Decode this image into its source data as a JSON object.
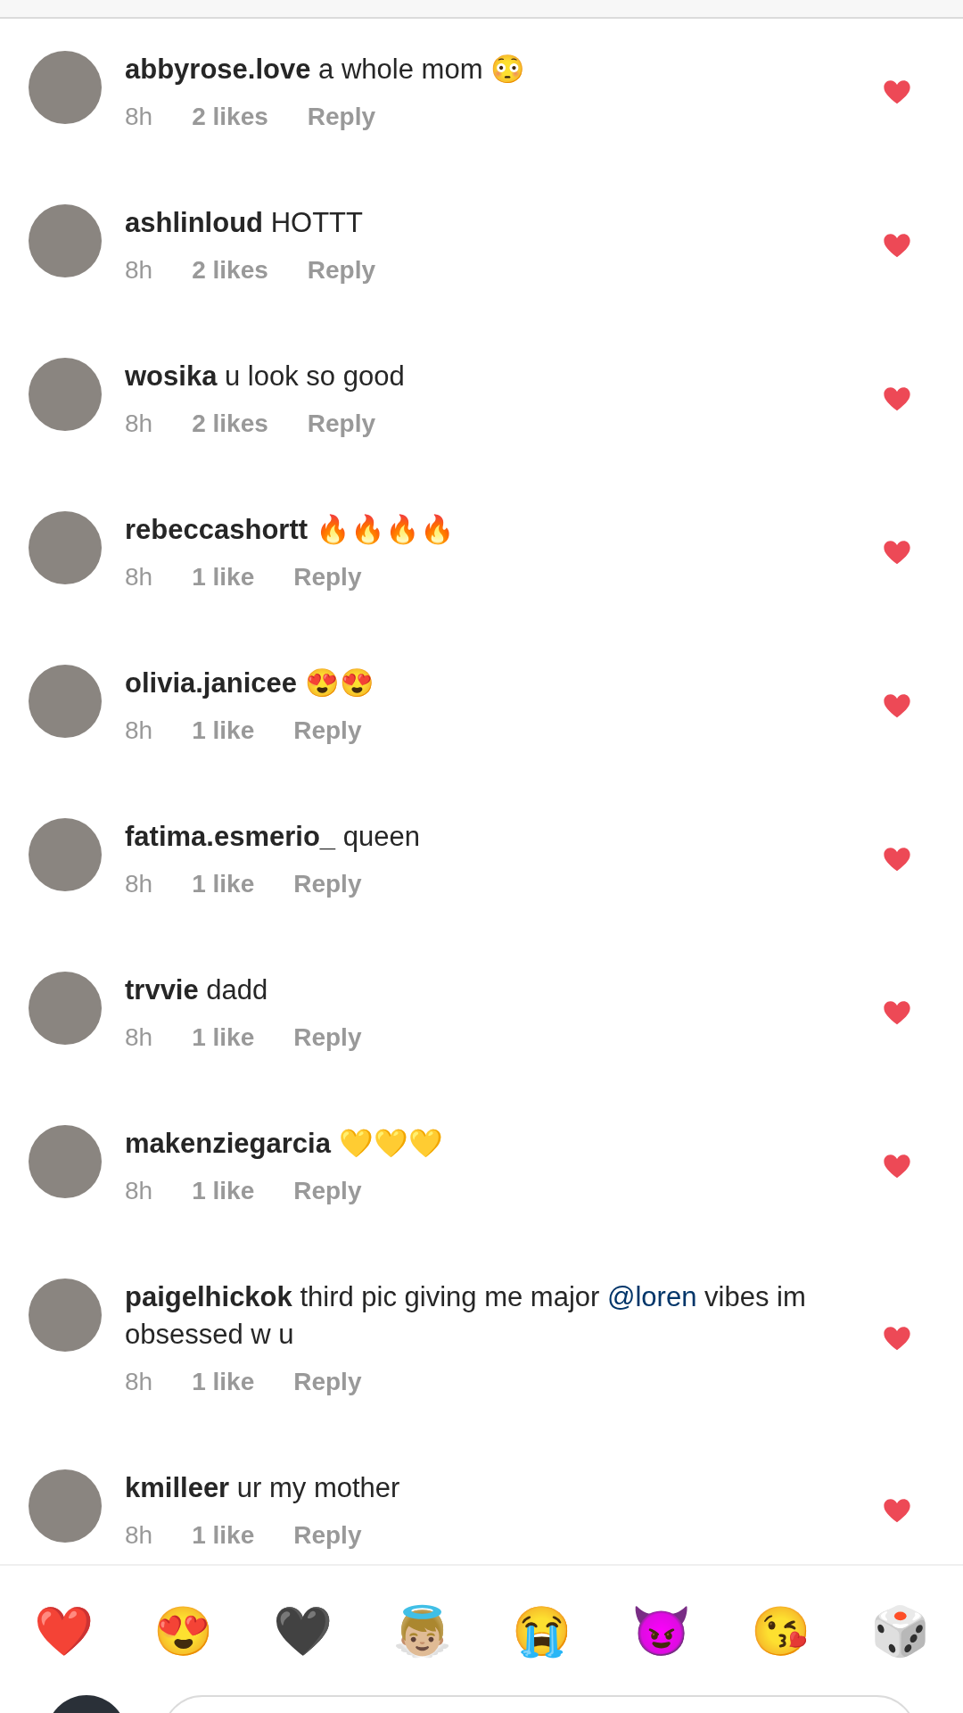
{
  "comments": [
    {
      "username": "abbyrose.love",
      "body": [
        {
          "kind": "text",
          "text": "a whole mom 😳"
        }
      ],
      "time": "8h",
      "likes": "2 likes",
      "reply": "Reply",
      "liked": true
    },
    {
      "username": "ashlinloud",
      "body": [
        {
          "kind": "text",
          "text": "HOTTT"
        }
      ],
      "time": "8h",
      "likes": "2 likes",
      "reply": "Reply",
      "liked": true
    },
    {
      "username": "wosika",
      "body": [
        {
          "kind": "text",
          "text": "u look so good"
        }
      ],
      "time": "8h",
      "likes": "2 likes",
      "reply": "Reply",
      "liked": true
    },
    {
      "username": "rebeccashortt",
      "body": [
        {
          "kind": "text",
          "text": "🔥🔥🔥🔥"
        }
      ],
      "time": "8h",
      "likes": "1 like",
      "reply": "Reply",
      "liked": true
    },
    {
      "username": "olivia.janicee",
      "body": [
        {
          "kind": "text",
          "text": "😍😍"
        }
      ],
      "time": "8h",
      "likes": "1 like",
      "reply": "Reply",
      "liked": true
    },
    {
      "username": "fatima.esmerio_",
      "body": [
        {
          "kind": "text",
          "text": "queen"
        }
      ],
      "time": "8h",
      "likes": "1 like",
      "reply": "Reply",
      "liked": true
    },
    {
      "username": "trvvie",
      "body": [
        {
          "kind": "text",
          "text": "dadd"
        }
      ],
      "time": "8h",
      "likes": "1 like",
      "reply": "Reply",
      "liked": true
    },
    {
      "username": "makenziegarcia",
      "body": [
        {
          "kind": "text",
          "text": "💛💛💛"
        }
      ],
      "time": "8h",
      "likes": "1 like",
      "reply": "Reply",
      "liked": true
    },
    {
      "username": "paigelhickok",
      "body": [
        {
          "kind": "text",
          "text": "third pic giving me major "
        },
        {
          "kind": "mention",
          "text": "@loren"
        },
        {
          "kind": "text",
          "text": " vibes im obsessed w u"
        }
      ],
      "time": "8h",
      "likes": "1 like",
      "reply": "Reply",
      "liked": true
    },
    {
      "username": "kmilleer",
      "body": [
        {
          "kind": "text",
          "text": "ur my mother"
        }
      ],
      "time": "8h",
      "likes": "1 like",
      "reply": "Reply",
      "liked": true
    }
  ],
  "quick_reactions": [
    "❤️",
    "😍",
    "🖤",
    "👼🏼",
    "😭",
    "😈",
    "😘",
    "🎲"
  ]
}
